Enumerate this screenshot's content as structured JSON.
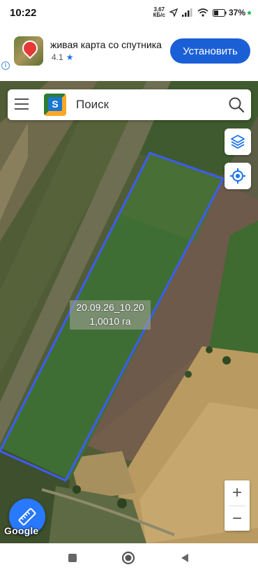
{
  "status_bar": {
    "time": "10:22",
    "net_speed_value": "3,67",
    "net_speed_unit": "КБ/с",
    "battery": "37%"
  },
  "ad": {
    "title": "живая карта со спутника",
    "rating": "4.1",
    "install_label": "Установить",
    "info_glyph": "i"
  },
  "search": {
    "placeholder": "Поиск",
    "logo_letter": "S"
  },
  "plot": {
    "name": "20.09.26_10.20",
    "area": "1,0010 га"
  },
  "map_controls": {
    "zoom_in": "+",
    "zoom_out": "−",
    "attribution": "Google"
  },
  "colors": {
    "accent": "#1a5fd6",
    "plot_outline": "#3d5cf2",
    "ruler_button": "#2979ff"
  },
  "icons": [
    "menu-icon",
    "search-icon",
    "layers-icon",
    "my-location-icon",
    "ruler-icon",
    "star-icon"
  ]
}
